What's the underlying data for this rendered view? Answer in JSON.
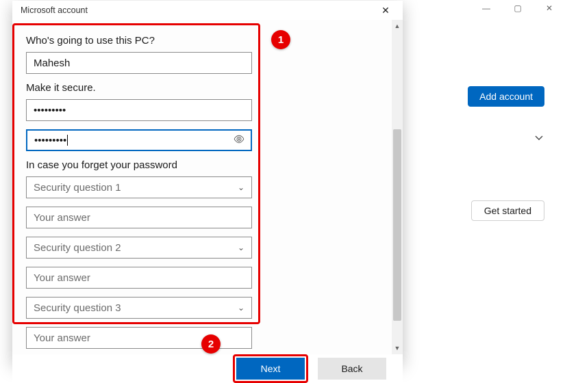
{
  "background": {
    "window_controls": {
      "minimize": "—",
      "maximize": "▢",
      "close": "✕"
    },
    "add_account_label": "Add account",
    "get_started_label": "Get started"
  },
  "dialog": {
    "title": "Microsoft account",
    "close_glyph": "✕",
    "labels": {
      "who_uses_pc": "Who's going to use this PC?",
      "make_secure": "Make it secure.",
      "forget_password": "In case you forget your password"
    },
    "fields": {
      "username_value": "Mahesh",
      "password_mask": "•••••••••",
      "confirm_mask": "•••••••••",
      "sq1_placeholder": "Security question 1",
      "ans1_placeholder": "Your answer",
      "sq2_placeholder": "Security question 2",
      "ans2_placeholder": "Your answer",
      "sq3_placeholder": "Security question 3",
      "ans3_placeholder": "Your answer"
    },
    "buttons": {
      "next": "Next",
      "back": "Back"
    }
  },
  "annotations": {
    "callout_1": "1",
    "callout_2": "2"
  }
}
